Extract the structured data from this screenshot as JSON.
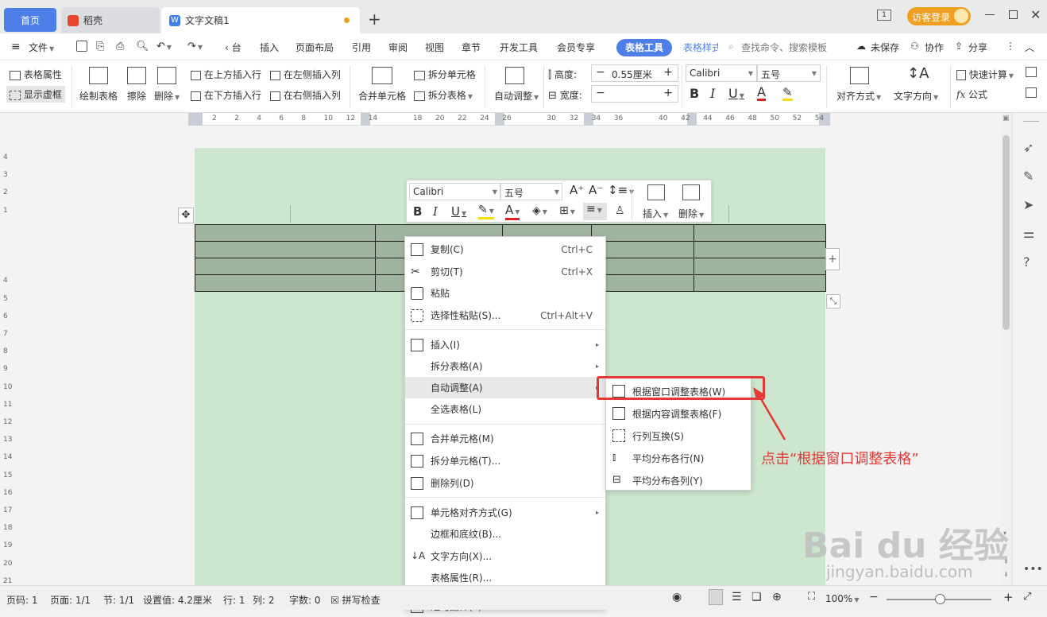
{
  "tabs": {
    "home": "首页",
    "daoke": "稻壳",
    "doc": "文字文稿1",
    "add": "+"
  },
  "titlebar": {
    "page_badge": "1",
    "visitor_login": "访客登录"
  },
  "menu": {
    "file": "文件",
    "items": [
      "‹ 台",
      "插入",
      "页面布局",
      "引用",
      "审阅",
      "视图",
      "章节",
      "开发工具",
      "会员专享"
    ],
    "table_tools": "表格工具",
    "table_style": "表格样式",
    "search_placeholder": "查找命令、搜索模板",
    "unsaved": "未保存",
    "collab": "协作",
    "share": "分享"
  },
  "ribbon": {
    "table_props": "表格属性",
    "show_gridlines": "显示虚框",
    "draw_table": "绘制表格",
    "erase": "擦除",
    "delete": "删除",
    "insert_above": "在上方插入行",
    "insert_left": "在左侧插入列",
    "insert_below": "在下方插入行",
    "insert_right": "在右侧插入列",
    "merge_cells": "合并单元格",
    "split_cells": "拆分单元格",
    "split_table": "拆分表格",
    "auto_adjust": "自动调整",
    "height_label": "高度:",
    "height_value": "0.55厘米",
    "width_label": "宽度:",
    "width_value": "",
    "font": "Calibri",
    "size": "五号",
    "align": "对齐方式",
    "text_dir": "文字方向",
    "quick_calc": "快速计算",
    "formula": "公式"
  },
  "ruler_h": [
    "2",
    "2",
    "4",
    "6",
    "8",
    "10",
    "12",
    "14",
    "",
    "18",
    "20",
    "22",
    "24",
    "26",
    "",
    "30",
    "32",
    "34",
    "36",
    "",
    "40",
    "42",
    "44",
    "46",
    "48",
    "50",
    "52",
    "54"
  ],
  "ruler_v": [
    "4",
    "3",
    "2",
    "1",
    "",
    "",
    "",
    "4",
    "5",
    "6",
    "7",
    "8",
    "9",
    "10",
    "11",
    "12",
    "13",
    "14",
    "15",
    "16",
    "17",
    "18",
    "19",
    "20",
    "21"
  ],
  "mini_toolbar": {
    "font": "Calibri",
    "size": "五号",
    "insert": "插入",
    "delete": "删除"
  },
  "context_menu": [
    {
      "label": "复制(C)",
      "shortcut": "Ctrl+C"
    },
    {
      "label": "剪切(T)",
      "shortcut": "Ctrl+X"
    },
    {
      "label": "粘贴",
      "shortcut": ""
    },
    {
      "label": "选择性粘贴(S)...",
      "shortcut": "Ctrl+Alt+V"
    },
    {
      "label": "插入(I)",
      "shortcut": ""
    },
    {
      "label": "拆分表格(A)",
      "shortcut": ""
    },
    {
      "label": "自动调整(A)",
      "shortcut": ""
    },
    {
      "label": "全选表格(L)",
      "shortcut": ""
    },
    {
      "label": "合并单元格(M)",
      "shortcut": ""
    },
    {
      "label": "拆分单元格(T)...",
      "shortcut": ""
    },
    {
      "label": "删除列(D)",
      "shortcut": ""
    },
    {
      "label": "单元格对齐方式(G)",
      "shortcut": ""
    },
    {
      "label": "边框和底纹(B)...",
      "shortcut": ""
    },
    {
      "label": "文字方向(X)...",
      "shortcut": ""
    },
    {
      "label": "表格属性(R)...",
      "shortcut": ""
    },
    {
      "label": "短句翻译(T)",
      "shortcut": ""
    }
  ],
  "submenu": [
    "根据窗口调整表格(W)",
    "根据内容调整表格(F)",
    "行列互换(S)",
    "平均分布各行(N)",
    "平均分布各列(Y)"
  ],
  "annotation": "点击“根据窗口调整表格”",
  "status": {
    "page_code": "页码: 1",
    "page": "页面: 1/1",
    "section": "节: 1/1",
    "setting": "设置值: 4.2厘米",
    "row": "行: 1",
    "col": "列: 2",
    "words": "字数: 0",
    "spell": "拼写检查",
    "zoom": "100%"
  },
  "watermark": {
    "logo": "Bai du 经验",
    "url": "jingyan.baidu.com"
  },
  "colors": {
    "accent": "#4e7fe8",
    "highlight": "#e53935",
    "table_cell": "#9fb49f",
    "page_bg": "#cde6cf",
    "visitor": "#f0a020"
  }
}
